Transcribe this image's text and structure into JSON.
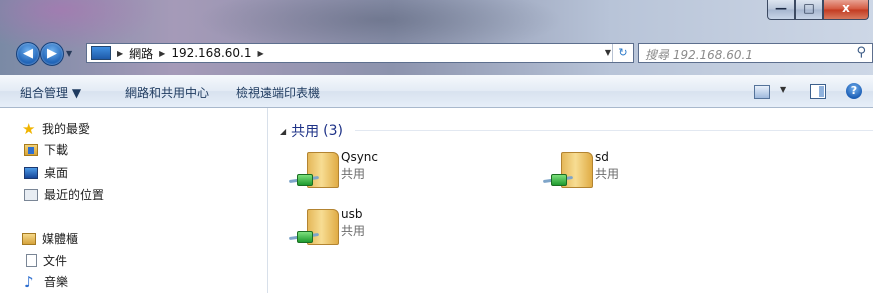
{
  "window": {
    "buttons": {
      "minimize": "—",
      "maximize": "□",
      "close": "x"
    }
  },
  "navigation": {
    "back_symbol": "◀",
    "forward_symbol": "▶",
    "breadcrumb": [
      "網路",
      "192.168.60.1"
    ],
    "search_placeholder": "搜尋 192.168.60.1"
  },
  "command_bar": {
    "organize": "組合管理 ▼",
    "network_center": "網路和共用中心",
    "printers": "檢視遠端印表機",
    "help": "?"
  },
  "sidebar": {
    "favorites_label": "我的最愛",
    "favorites": [
      "下載",
      "桌面",
      "最近的位置"
    ],
    "libraries_label": "媒體櫃",
    "libraries": [
      "文件",
      "音樂"
    ]
  },
  "content": {
    "group_title": "共用",
    "group_count": "(3)",
    "items": [
      {
        "name": "Qsync",
        "type": "共用"
      },
      {
        "name": "sd",
        "type": "共用"
      },
      {
        "name": "usb",
        "type": "共用"
      }
    ]
  },
  "icons": {
    "folder_color": "#f1cd73",
    "share_color": "#2fb23f",
    "accent": "#1e3287"
  }
}
